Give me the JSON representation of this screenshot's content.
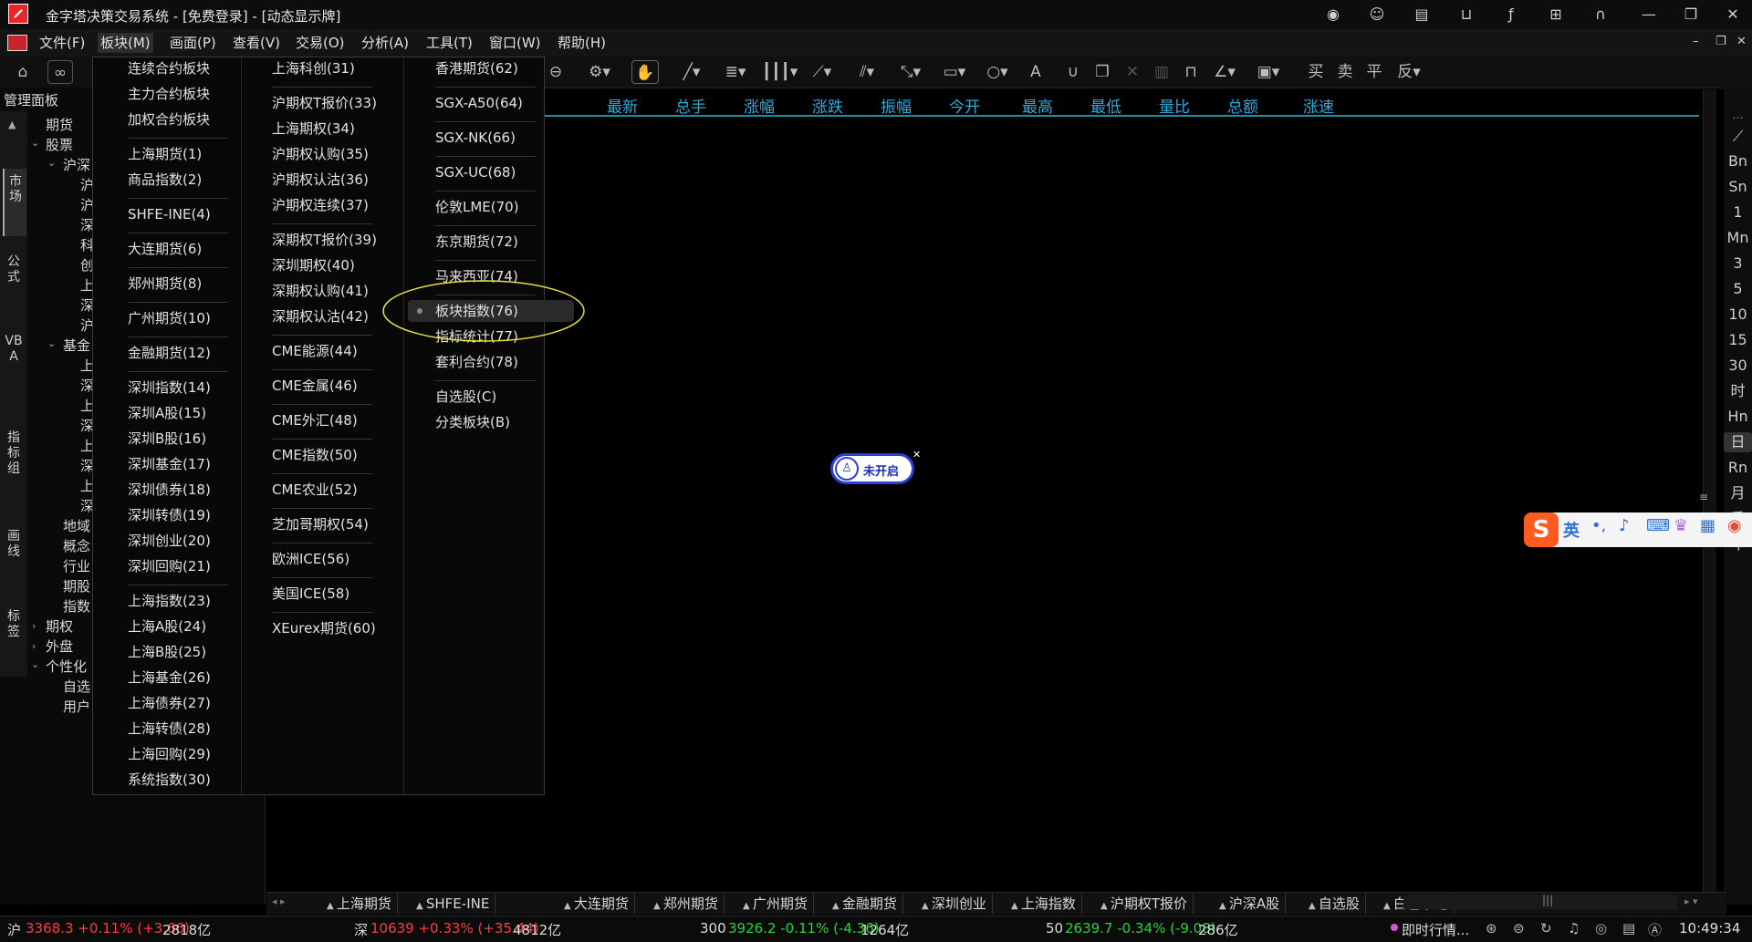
{
  "title": "金字塔决策交易系统 - [免费登录] - [动态显示牌]",
  "menu": [
    "文件(F)",
    "板块(M)",
    "画面(P)",
    "查看(V)",
    "交易(O)",
    "分析(A)",
    "工具(T)",
    "窗口(W)",
    "帮助(H)"
  ],
  "left_panel": {
    "title": "管理面板",
    "vtabs": [
      "市场",
      "公式",
      "VBA",
      "指标组",
      "画线",
      "标签"
    ],
    "tree": {
      "futures": "期货",
      "stocks": "股票",
      "hushen": "沪深",
      "stock_children": [
        "沪",
        "沪",
        "深",
        "科",
        "创",
        "上",
        "深",
        "沪"
      ],
      "fund": "基金",
      "fund_children": [
        "上",
        "深",
        "上",
        "深",
        "上",
        "深",
        "上",
        "深"
      ],
      "region": "地域",
      "concept": "概念",
      "industry": "行业",
      "futures_stock": "期股",
      "index": "指数",
      "options": "期权",
      "foreign": "外盘",
      "personal": "个性化",
      "selfpick": "自选",
      "user": "用户"
    }
  },
  "quote_header": [
    "最新",
    "总手",
    "涨幅",
    "涨跌",
    "振幅",
    "今开",
    "最高",
    "最低",
    "量比",
    "总额",
    "涨速"
  ],
  "dropdown": {
    "col1": [
      "连续合约板块",
      "主力合约板块",
      "加权合约板块",
      "上海期货(1)",
      "商品指数(2)",
      "SHFE-INE(4)",
      "大连期货(6)",
      "郑州期货(8)",
      "广州期货(10)",
      "金融期货(12)",
      "深圳指数(14)",
      "深圳A股(15)",
      "深圳B股(16)",
      "深圳基金(17)",
      "深圳债券(18)",
      "深圳转债(19)",
      "深圳创业(20)",
      "深圳回购(21)",
      "上海指数(23)",
      "上海A股(24)",
      "上海B股(25)",
      "上海基金(26)",
      "上海债券(27)",
      "上海转债(28)",
      "上海回购(29)",
      "系统指数(30)"
    ],
    "col2": [
      "上海科创(31)",
      "沪期权T报价(33)",
      "上海期权(34)",
      "沪期权认购(35)",
      "沪期权认沽(36)",
      "沪期权连续(37)",
      "深期权T报价(39)",
      "深圳期权(40)",
      "深期权认购(41)",
      "深期权认沽(42)",
      "CME能源(44)",
      "CME金属(46)",
      "CME外汇(48)",
      "CME指数(50)",
      "CME农业(52)",
      "芝加哥期权(54)",
      "欧洲ICE(56)",
      "美国ICE(58)",
      "XEurex期货(60)"
    ],
    "col3": [
      "香港期货(62)",
      "SGX-A50(64)",
      "SGX-NK(66)",
      "SGX-UC(68)",
      "伦敦LME(70)",
      "东京期货(72)",
      "马来西亚(74)",
      "板块指数(76)",
      "指标统计(77)",
      "套利合约(78)",
      "自选股(C)",
      "分类板块(B)"
    ]
  },
  "right_bar": [
    "Bn",
    "Sn",
    "1",
    "Mn",
    "3",
    "5",
    "10",
    "15",
    "30",
    "时",
    "Hn",
    "日",
    "Rn",
    "月",
    "季",
    "年"
  ],
  "notify_label": "未开启",
  "ime_label": "英",
  "bottom_tabs": [
    "上海期货",
    "SHFE-INE",
    "大连期货",
    "郑州期货",
    "广州期货",
    "金融期货",
    "深圳创业",
    "上海指数",
    "沪期权T报价",
    "沪深A股",
    "自选股",
    "白色家电"
  ],
  "status": {
    "sh_label": "沪",
    "sh_value": "3368.3 +0.11% (+3.66)",
    "sh_amount": "2818亿",
    "sz_label": "深",
    "sz_value": "10639 +0.33% (+35.44)",
    "sz_amount": "4812亿",
    "i300_label": "300",
    "i300_value": "3926.2 -0.11% (-4.36)",
    "i300_amount": "1264亿",
    "i50_label": "50",
    "i50_value": "2639.7 -0.34% (-9.08)",
    "i50_amount": "286亿",
    "news": "即时行情...",
    "time": "10:49:34"
  },
  "colors": {
    "accent": "#2ea9d8",
    "up": "#ff3c3c",
    "down": "#29d43a",
    "highlight_ring": "#e5e03a"
  }
}
